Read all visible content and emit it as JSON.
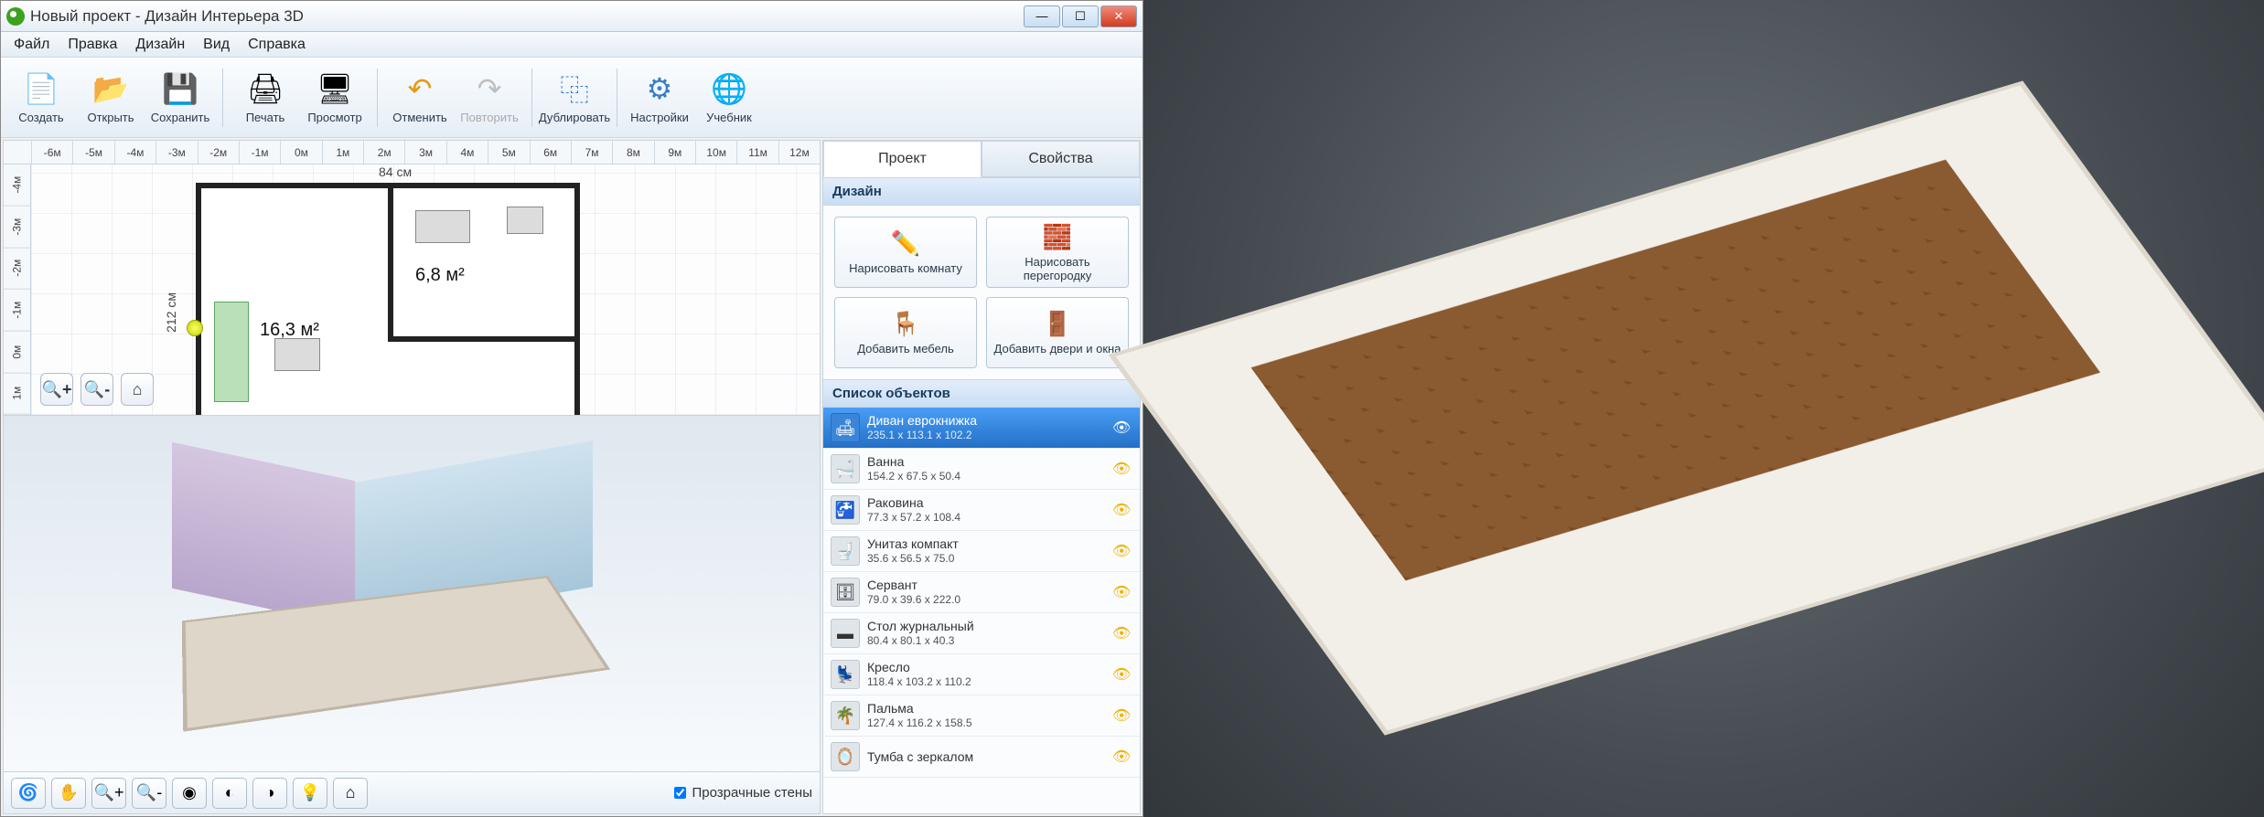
{
  "window": {
    "title": "Новый проект - Дизайн Интерьера 3D"
  },
  "menu": {
    "items": [
      "Файл",
      "Правка",
      "Дизайн",
      "Вид",
      "Справка"
    ]
  },
  "toolbar": {
    "create": "Создать",
    "open": "Открыть",
    "save": "Сохранить",
    "print": "Печать",
    "preview": "Просмотр",
    "undo": "Отменить",
    "redo": "Повторить",
    "duplicate": "Дублировать",
    "settings": "Настройки",
    "tutorial": "Учебник"
  },
  "ruler": {
    "h": [
      "-6м",
      "-5м",
      "-4м",
      "-3м",
      "-2м",
      "-1м",
      "0м",
      "1м",
      "2м",
      "3м",
      "4м",
      "5м",
      "6м",
      "7м",
      "8м",
      "9м",
      "10м",
      "11м",
      "12м"
    ],
    "v": [
      "-4м",
      "-3м",
      "-2м",
      "-1м",
      "0м",
      "1м"
    ]
  },
  "plan": {
    "room_a_area": "6,8 м²",
    "room_b_area": "16,3 м²",
    "dim_top": "84 см",
    "dim_left": "212 см"
  },
  "bottom": {
    "transparent_walls": "Прозрачные стены"
  },
  "tabs": {
    "project": "Проект",
    "properties": "Свойства"
  },
  "panel": {
    "design_header": "Дизайн",
    "draw_room": "Нарисовать комнату",
    "draw_partition": "Нарисовать перегородку",
    "add_furniture": "Добавить мебель",
    "add_doors": "Добавить двери и окна",
    "objects_header": "Список объектов"
  },
  "objects": [
    {
      "name": "Диван еврокнижка",
      "dims": "235.1 x 113.1 x 102.2",
      "icon": "🛋",
      "selected": true
    },
    {
      "name": "Ванна",
      "dims": "154.2 x 67.5 x 50.4",
      "icon": "🛁",
      "selected": false
    },
    {
      "name": "Раковина",
      "dims": "77.3 x 57.2 x 108.4",
      "icon": "🚰",
      "selected": false
    },
    {
      "name": "Унитаз компакт",
      "dims": "35.6 x 56.5 x 75.0",
      "icon": "🚽",
      "selected": false
    },
    {
      "name": "Сервант",
      "dims": "79.0 x 39.6 x 222.0",
      "icon": "🗄",
      "selected": false
    },
    {
      "name": "Стол журнальный",
      "dims": "80.4 x 80.1 x 40.3",
      "icon": "▬",
      "selected": false
    },
    {
      "name": "Кресло",
      "dims": "118.4 x 103.2 x 110.2",
      "icon": "💺",
      "selected": false
    },
    {
      "name": "Пальма",
      "dims": "127.4 x 116.2 x 158.5",
      "icon": "🌴",
      "selected": false
    },
    {
      "name": "Тумба с зеркалом",
      "dims": "",
      "icon": "🪞",
      "selected": false
    }
  ]
}
